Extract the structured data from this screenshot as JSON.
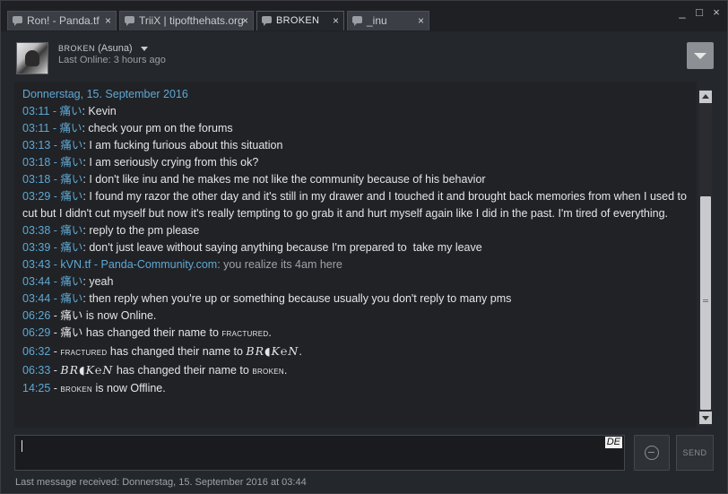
{
  "tabs": [
    {
      "label": "Ron! - Panda.tf",
      "close": "×"
    },
    {
      "label": "TriiX | tipofthehats.org",
      "close": "×"
    },
    {
      "label": "BROKEN",
      "close": "×",
      "active": true
    },
    {
      "label": "_inu",
      "close": "×"
    }
  ],
  "window_controls": {
    "minimize": "_",
    "maximize": "□",
    "close": "×"
  },
  "header": {
    "name_prefix": "BROKEN",
    "name_nick": "(Asuna)",
    "last_online": "Last Online: 3 hours ago"
  },
  "chat": {
    "date": "Donnerstag, 15. September 2016",
    "messages": [
      {
        "time": "03:11",
        "name": "痛い",
        "text": ": Kevin"
      },
      {
        "time": "03:11",
        "name": "痛い",
        "text": ": check your pm on the forums"
      },
      {
        "time": "03:13",
        "name": "痛い",
        "text": ": I am fucking furious about this situation"
      },
      {
        "time": "03:18",
        "name": "痛い",
        "text": ": I am seriously crying from this ok?"
      },
      {
        "time": "03:18",
        "name": "痛い",
        "text": ": I don't like inu and he makes me not like the community because of his behavior"
      },
      {
        "time": "03:29",
        "name": "痛い",
        "text": ": I found my razor the other day and it's still in my drawer and I touched it and brought back memories from when I used to cut but I didn't cut myself but now it's really tempting to go grab it and hurt myself again like I did in the past. I'm tired of everything."
      },
      {
        "time": "03:38",
        "name": "痛い",
        "text": ": reply to the pm please"
      },
      {
        "time": "03:39",
        "name": "痛い",
        "text": ": don't just leave without saying anything because I'm prepared to  take my leave"
      },
      {
        "time": "03:43",
        "name": "kVN.tf - Panda-Community.com",
        "text": ": you realize its 4am here",
        "grey": true
      },
      {
        "time": "03:44",
        "name": "痛い",
        "text": ": yeah"
      },
      {
        "time": "03:44",
        "name": "痛い",
        "text": ": then reply when you're up or something because usually you don't reply to many pms"
      }
    ],
    "events": {
      "e1_time": "06:26",
      "e1_name": "痛い",
      "e1_text": " is now Online.",
      "e2_time": "06:29",
      "e2_name": "痛い",
      "e2_text": " has changed their name to ",
      "e2_new": "fractured",
      "e2_end": ".",
      "e3_time": "06:32",
      "e3_old": "fractured",
      "e3_text": " has changed their name to ",
      "e3_new": "BR◖K℮N",
      "e3_end": ".",
      "e4_time": "06:33",
      "e4_old": "BR◖K℮N",
      "e4_text": " has changed their name to ",
      "e4_new": "broken",
      "e4_end": ".",
      "e5_time": "14:25",
      "e5_name": "broken",
      "e5_text": " is now Offline."
    }
  },
  "input": {
    "lang_badge": "DE"
  },
  "send_label": "SEND",
  "footer": "Last message received: Donnerstag, 15. September 2016 at 03:44",
  "colors": {
    "accent": "#5fa8d3",
    "background": "#24272c",
    "chat_bg": "#202226"
  }
}
